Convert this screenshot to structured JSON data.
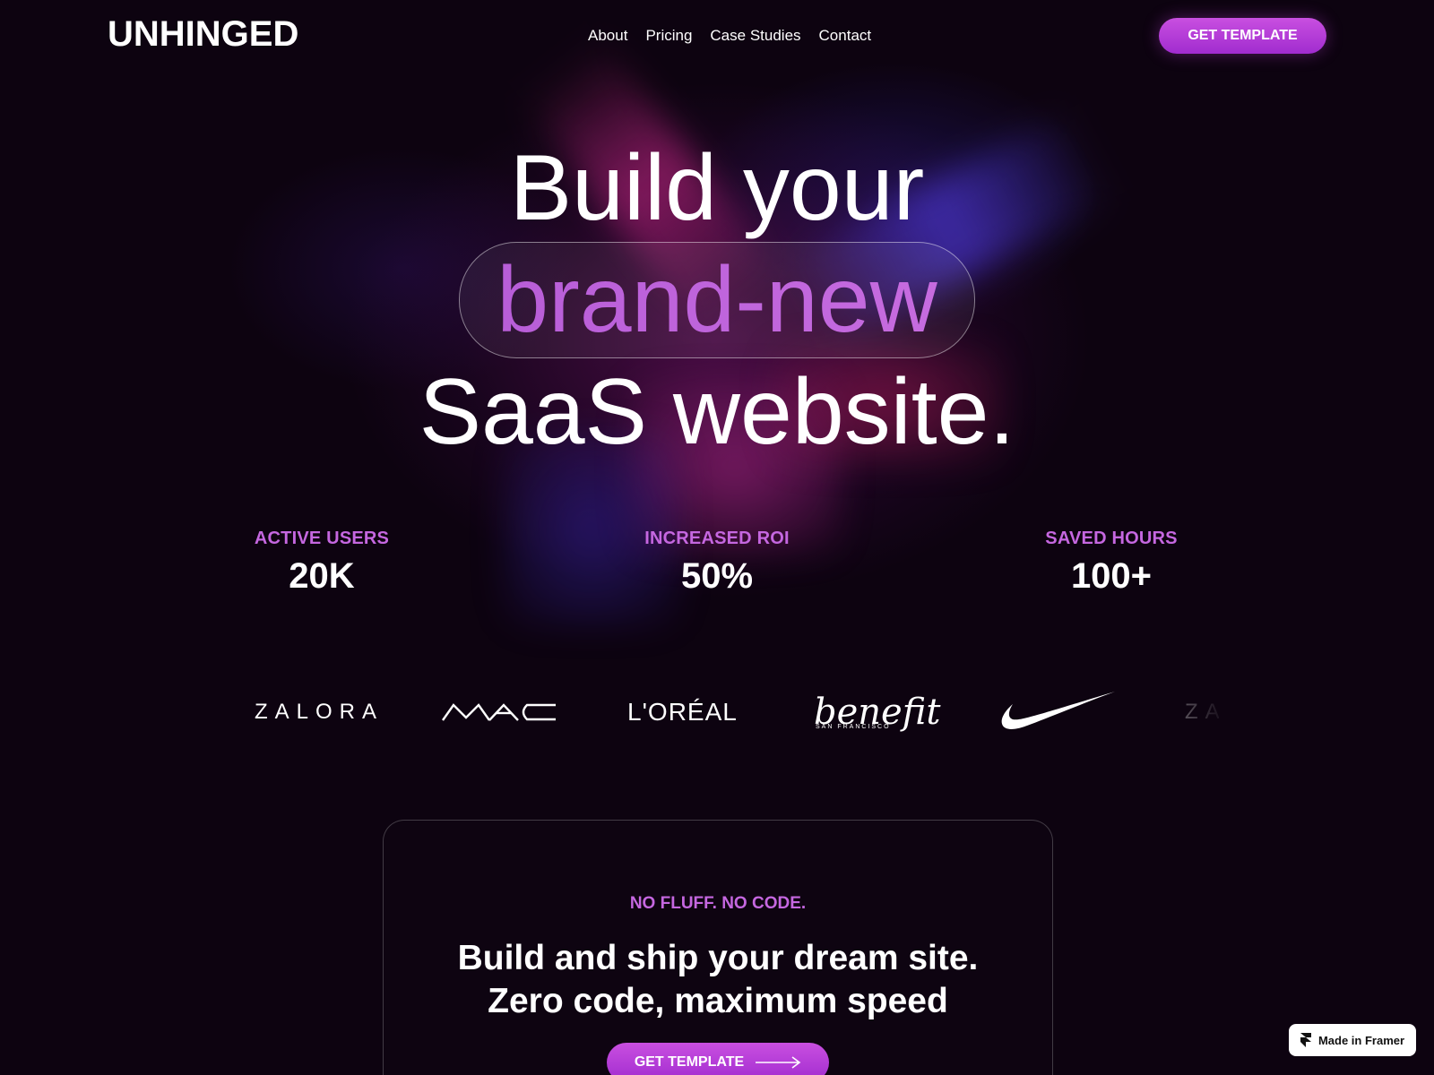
{
  "header": {
    "logo": "UNHINGED",
    "nav": [
      "About",
      "Pricing",
      "Case Studies",
      "Contact"
    ],
    "cta_label": "GET TEMPLATE"
  },
  "hero": {
    "line1": "Build your",
    "line2": "brand-new",
    "line3": "SaaS website."
  },
  "stats": [
    {
      "label": "ACTIVE USERS",
      "value": "20K"
    },
    {
      "label": "INCREASED ROI",
      "value": "50%"
    },
    {
      "label": "SAVED HOURS",
      "value": "100+"
    }
  ],
  "brands": {
    "zalora": "ZALORA",
    "mac": "MAC",
    "loreal": "L'ORÉAL",
    "benefit": "benefit",
    "benefit_sub": "SAN FRANCISCO",
    "nike": "nike-swoosh-icon"
  },
  "card": {
    "eyebrow": "NO FLUFF. NO CODE.",
    "title_line1": "Build and ship your dream site.",
    "title_line2": "Zero code, maximum speed",
    "cta_label": "GET TEMPLATE"
  },
  "badge": {
    "label": "Made in Framer",
    "icon": "framer-icon"
  },
  "colors": {
    "background": "#0d0310",
    "accent": "#b93ed6",
    "accent_text": "#c567e0",
    "text": "#ffffff"
  }
}
